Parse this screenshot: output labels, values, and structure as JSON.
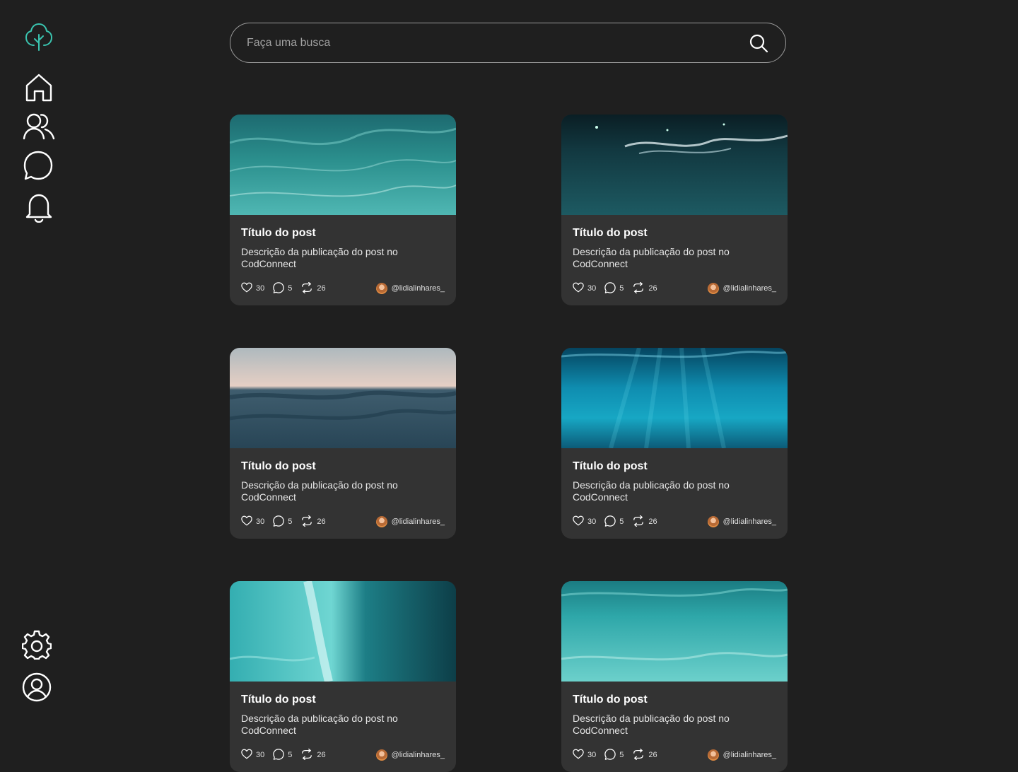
{
  "brand": {
    "icon": "tree-logo-icon",
    "color": "#3ac5b0"
  },
  "sidebar": {
    "items": [
      {
        "icon": "home-icon"
      },
      {
        "icon": "users-icon"
      },
      {
        "icon": "chat-bubble-icon"
      },
      {
        "icon": "bell-icon"
      }
    ],
    "bottom_items": [
      {
        "icon": "settings-gear-icon"
      },
      {
        "icon": "user-profile-icon"
      }
    ]
  },
  "search": {
    "placeholder": "Faça uma busca",
    "value": "",
    "icon": "search-icon"
  },
  "posts": [
    {
      "title": "Título do post",
      "description": "Descrição da publicação do post no CodConnect",
      "likes": "30",
      "comments": "5",
      "shares": "26",
      "author": "@lidialinhares_",
      "image": "ocean-wave"
    },
    {
      "title": "Título do post",
      "description": "Descrição da publicação do post no CodConnect",
      "likes": "30",
      "comments": "5",
      "shares": "26",
      "author": "@lidialinhares_",
      "image": "underwater-surface"
    },
    {
      "title": "Título do post",
      "description": "Descrição da publicação do post no CodConnect",
      "likes": "30",
      "comments": "5",
      "shares": "26",
      "author": "@lidialinhares_",
      "image": "sea-horizon"
    },
    {
      "title": "Título do post",
      "description": "Descrição da publicação do post no CodConnect",
      "likes": "30",
      "comments": "5",
      "shares": "26",
      "author": "@lidialinhares_",
      "image": "underwater-light"
    },
    {
      "title": "Título do post",
      "description": "Descrição da publicação do post no CodConnect",
      "likes": "30",
      "comments": "5",
      "shares": "26",
      "author": "@lidialinhares_",
      "image": "breaking-wave"
    },
    {
      "title": "Título do post",
      "description": "Descrição da publicação do post no CodConnect",
      "likes": "30",
      "comments": "5",
      "shares": "26",
      "author": "@lidialinhares_",
      "image": "shallow-water"
    }
  ]
}
